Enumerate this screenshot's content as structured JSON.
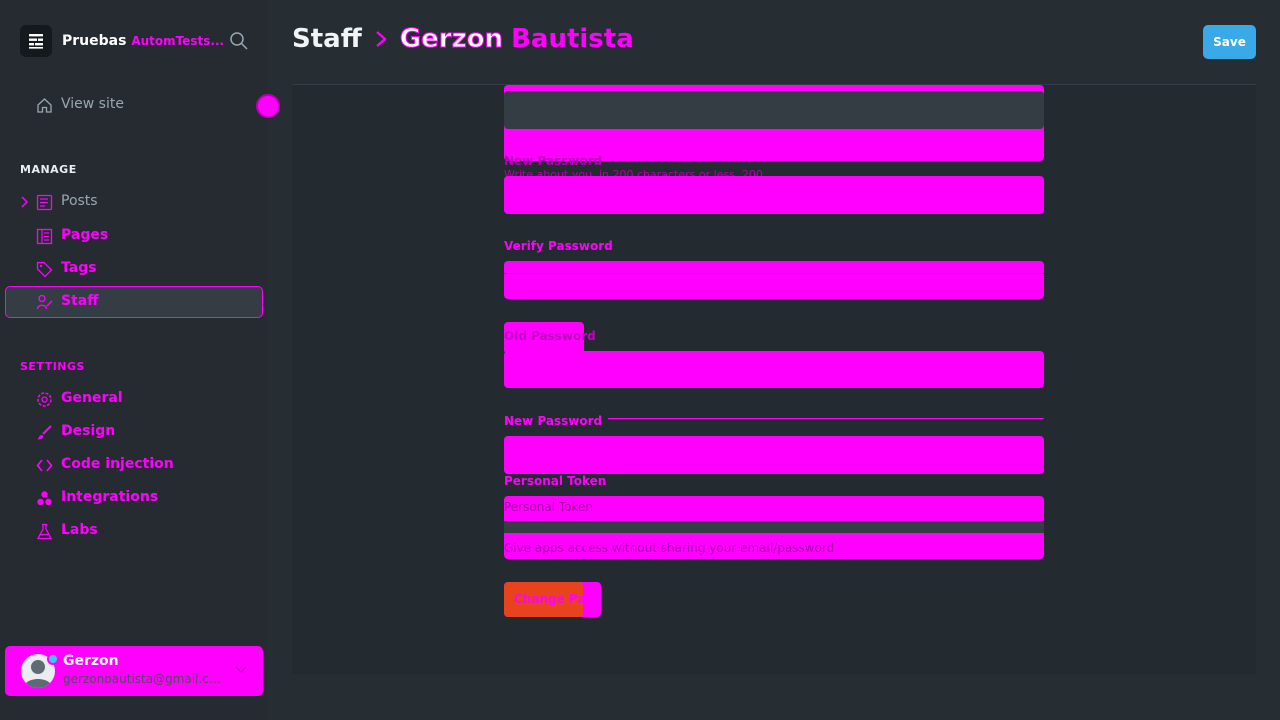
{
  "brand": {
    "name": "Pruebas",
    "name_rest": "AutomTests..."
  },
  "sidebar": {
    "view_site": "View site",
    "manage_title": "MANAGE",
    "settings_title": "SETTINGS",
    "manage_items": [
      {
        "label": "Posts"
      },
      {
        "label": "Pages"
      },
      {
        "label": "Tags"
      },
      {
        "label": "Staff"
      }
    ],
    "settings_items": [
      {
        "label": "General"
      },
      {
        "label": "Design"
      },
      {
        "label": "Code injection"
      },
      {
        "label": "Integrations"
      },
      {
        "label": "Labs"
      }
    ]
  },
  "user": {
    "name": "Gerzon",
    "email": "gerzonbautista@gmail.com"
  },
  "header": {
    "crumb_parent": "Staff",
    "crumb_first": "Gerzon",
    "crumb_last": "Bautista",
    "save_label": "Save"
  },
  "form": {
    "label_new_password": "New Password",
    "bio_hint": "Write about you, in 200 characters or less. 200",
    "label_verify_password": "Verify Password",
    "label_old_password": "Old Password",
    "label_new_password_2": "New Password",
    "label_personal_token": "Personal Token",
    "token_value": "Personal Token",
    "token_hint": "Give apps access without sharing your email/password",
    "change_password_button": "Change Password"
  },
  "colors": {
    "accent": "#ff00ff",
    "save": "#3aa9e8",
    "danger": "#e9431d"
  }
}
